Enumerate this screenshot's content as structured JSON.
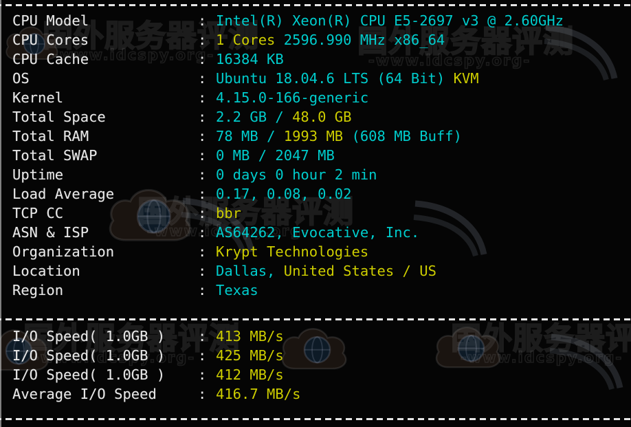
{
  "terminal": {
    "colors": {
      "background": "#050505",
      "label": "#e8e8e8",
      "value_cyan": "#00cdcd",
      "value_yellow": "#cdcd00",
      "divider": "#e6e6e6"
    },
    "separator_top": "----------------------------------------------------------------------",
    "separator_middle": "----------------------------------------------------------------------",
    "separator_bottom": "----------------------------------------------------------------------",
    "colon": ":"
  },
  "watermark": {
    "chinese_text": "国外服务器评测",
    "url_text": "-www.idcspy.org-"
  },
  "sysinfo": [
    {
      "label": "CPU Model",
      "segments": [
        {
          "text": "Intel(R) Xeon(R) CPU E5-2697 v3 @ 2.60GHz",
          "color": "cyan"
        }
      ]
    },
    {
      "label": "CPU Cores",
      "segments": [
        {
          "text": "1 Cores",
          "color": "yellow"
        },
        {
          "text": " ",
          "color": "cyan"
        },
        {
          "text": "2596.990 MHz x86_64",
          "color": "cyan"
        }
      ]
    },
    {
      "label": "CPU Cache",
      "segments": [
        {
          "text": "16384 KB",
          "color": "cyan"
        }
      ]
    },
    {
      "label": "OS",
      "segments": [
        {
          "text": "Ubuntu 18.04.6 LTS (64 Bit) ",
          "color": "cyan"
        },
        {
          "text": "KVM",
          "color": "yellow"
        }
      ]
    },
    {
      "label": "Kernel",
      "segments": [
        {
          "text": "4.15.0-166-generic",
          "color": "cyan"
        }
      ]
    },
    {
      "label": "Total Space",
      "segments": [
        {
          "text": "2.2 GB ",
          "color": "cyan"
        },
        {
          "text": "/ ",
          "color": "cyan"
        },
        {
          "text": "48.0 GB",
          "color": "yellow"
        }
      ]
    },
    {
      "label": "Total RAM",
      "segments": [
        {
          "text": "78 MB ",
          "color": "cyan"
        },
        {
          "text": "/ ",
          "color": "cyan"
        },
        {
          "text": "1993 MB ",
          "color": "yellow"
        },
        {
          "text": "(608 MB Buff)",
          "color": "cyan"
        }
      ]
    },
    {
      "label": "Total SWAP",
      "segments": [
        {
          "text": "0 MB / 2047 MB",
          "color": "cyan"
        }
      ]
    },
    {
      "label": "Uptime",
      "segments": [
        {
          "text": "0 days 0 hour 2 min",
          "color": "cyan"
        }
      ]
    },
    {
      "label": "Load Average",
      "segments": [
        {
          "text": "0.17, 0.08, 0.02",
          "color": "cyan"
        }
      ]
    },
    {
      "label": "TCP CC",
      "segments": [
        {
          "text": "bbr",
          "color": "yellow"
        }
      ]
    },
    {
      "label": "ASN & ISP",
      "segments": [
        {
          "text": "AS64262, Evocative, Inc.",
          "color": "cyan"
        }
      ]
    },
    {
      "label": "Organization",
      "segments": [
        {
          "text": "Krypt Technologies",
          "color": "yellow"
        }
      ]
    },
    {
      "label": "Location",
      "segments": [
        {
          "text": "Dallas, ",
          "color": "cyan"
        },
        {
          "text": "United States / US",
          "color": "yellow"
        }
      ]
    },
    {
      "label": "Region",
      "segments": [
        {
          "text": "Texas",
          "color": "cyan"
        }
      ]
    }
  ],
  "io_results": [
    {
      "label": "I/O Speed( 1.0GB )",
      "segments": [
        {
          "text": "413 MB/s",
          "color": "yellow"
        }
      ]
    },
    {
      "label": "I/O Speed( 1.0GB )",
      "segments": [
        {
          "text": "425 MB/s",
          "color": "yellow"
        }
      ]
    },
    {
      "label": "I/O Speed( 1.0GB )",
      "segments": [
        {
          "text": "412 MB/s",
          "color": "yellow"
        }
      ]
    },
    {
      "label": "Average I/O Speed",
      "segments": [
        {
          "text": "416.7 MB/s",
          "color": "yellow"
        }
      ]
    }
  ]
}
